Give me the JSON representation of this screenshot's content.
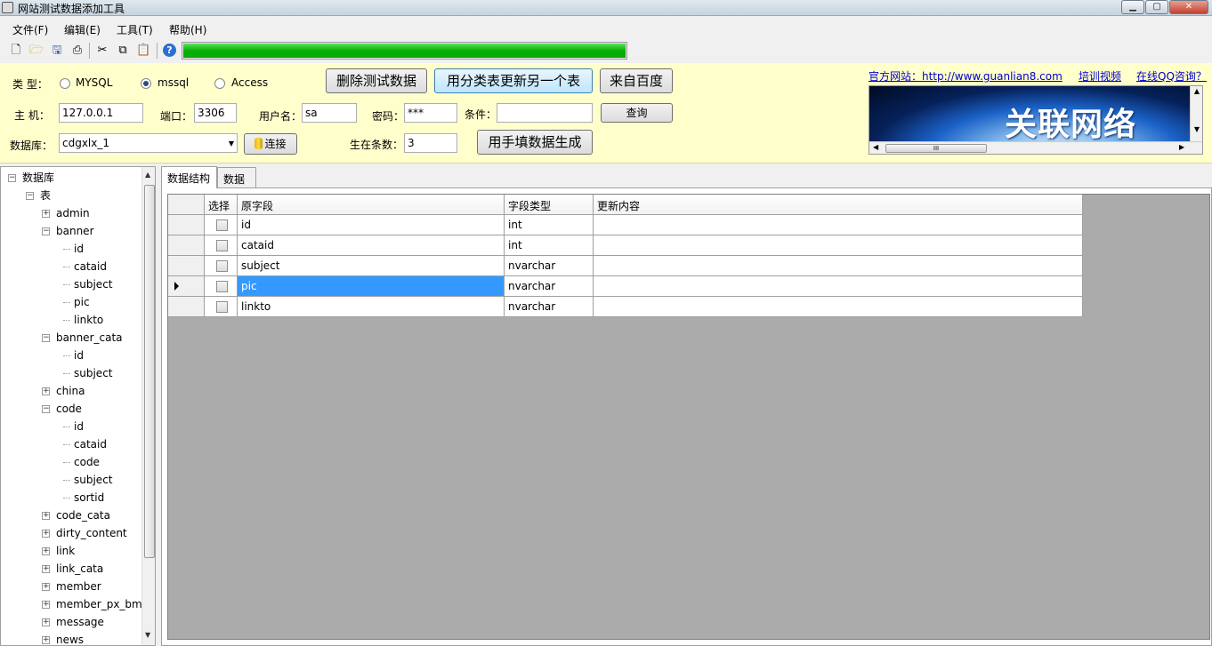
{
  "window": {
    "title": "网站测试数据添加工具"
  },
  "menu": [
    "文件(F)",
    "编辑(E)",
    "工具(T)",
    "帮助(H)"
  ],
  "toolbar": {
    "progress_percent": 100
  },
  "form": {
    "type_label": "类  型：",
    "types": [
      "MYSQL",
      "mssql",
      "Access"
    ],
    "selected_type": "mssql",
    "host_label": "主  机：",
    "host": "127.0.0.1",
    "port_label": "端口：",
    "port": "3306",
    "user_label": "用户名：",
    "user": "sa",
    "password_label": "密码：",
    "password": "***",
    "condition_label": "条件：",
    "condition": "",
    "database_label": "数据库：",
    "database": "cdgxlx_1",
    "connect_label": "连接",
    "count_label": "生在条数：",
    "count": "3",
    "delete_btn": "删除测试数据",
    "update_btn": "用分类表更新另一个表",
    "baidu_btn": "来自百度",
    "query_btn": "查询",
    "manual_btn": "用手填数据生成"
  },
  "links": {
    "site": "官方网站：http://www.guanlian8.com",
    "training": "培训视频",
    "qq": "在线QQ咨询？"
  },
  "banner": {
    "text": "关联网络",
    "hthumb": "III"
  },
  "tree": [
    {
      "label": "数据库",
      "level": 0,
      "exp": "-"
    },
    {
      "label": "表",
      "level": 1,
      "exp": "-"
    },
    {
      "label": "admin",
      "level": 2,
      "exp": "+"
    },
    {
      "label": "banner",
      "level": 2,
      "exp": "-"
    },
    {
      "label": "id",
      "level": 3,
      "exp": ""
    },
    {
      "label": "cataid",
      "level": 3,
      "exp": ""
    },
    {
      "label": "subject",
      "level": 3,
      "exp": ""
    },
    {
      "label": "pic",
      "level": 3,
      "exp": ""
    },
    {
      "label": "linkto",
      "level": 3,
      "exp": ""
    },
    {
      "label": "banner_cata",
      "level": 2,
      "exp": "-"
    },
    {
      "label": "id",
      "level": 3,
      "exp": ""
    },
    {
      "label": "subject",
      "level": 3,
      "exp": ""
    },
    {
      "label": "china",
      "level": 2,
      "exp": "+"
    },
    {
      "label": "code",
      "level": 2,
      "exp": "-"
    },
    {
      "label": "id",
      "level": 3,
      "exp": ""
    },
    {
      "label": "cataid",
      "level": 3,
      "exp": ""
    },
    {
      "label": "code",
      "level": 3,
      "exp": ""
    },
    {
      "label": "subject",
      "level": 3,
      "exp": ""
    },
    {
      "label": "sortid",
      "level": 3,
      "exp": ""
    },
    {
      "label": "code_cata",
      "level": 2,
      "exp": "+"
    },
    {
      "label": "dirty_content",
      "level": 2,
      "exp": "+"
    },
    {
      "label": "link",
      "level": 2,
      "exp": "+"
    },
    {
      "label": "link_cata",
      "level": 2,
      "exp": "+"
    },
    {
      "label": "member",
      "level": 2,
      "exp": "+"
    },
    {
      "label": "member_px_bm",
      "level": 2,
      "exp": "+"
    },
    {
      "label": "message",
      "level": 2,
      "exp": "+"
    },
    {
      "label": "news",
      "level": 2,
      "exp": "+"
    }
  ],
  "tabs": [
    "数据结构",
    "数据"
  ],
  "grid": {
    "columns": [
      "",
      "选择",
      "原字段",
      "字段类型",
      "更新内容"
    ],
    "rows": [
      {
        "field": "id",
        "type": "int",
        "content": "",
        "current": false
      },
      {
        "field": "cataid",
        "type": "int",
        "content": "",
        "current": false
      },
      {
        "field": "subject",
        "type": "nvarchar",
        "content": "",
        "current": false
      },
      {
        "field": "pic",
        "type": "nvarchar",
        "content": "",
        "current": true
      },
      {
        "field": "linkto",
        "type": "nvarchar",
        "content": "",
        "current": false
      }
    ]
  },
  "colors": {
    "panel_bg": "#ffffcc",
    "progress": "#06b006",
    "selection": "#3399ff",
    "grid_bg": "#ababab"
  }
}
